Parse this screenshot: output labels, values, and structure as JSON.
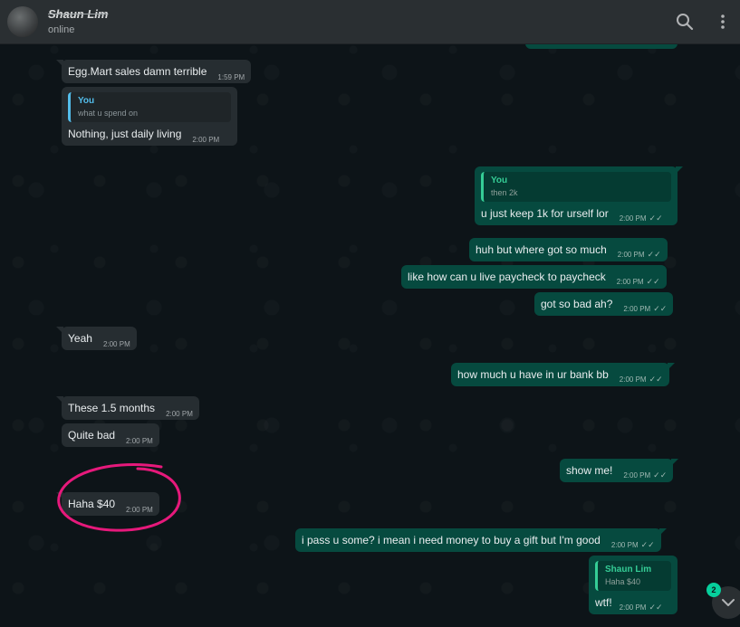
{
  "header": {
    "contact_name": "Shaun Lim",
    "status": "online",
    "icons": [
      "search-icon",
      "menu-icon"
    ]
  },
  "colors": {
    "header_bg": "#2a2f32",
    "chat_bg": "#0d1418",
    "incoming_bubble": "#262d31",
    "outgoing_bubble": "#064a3f",
    "highlight_circle": "#e6197b",
    "unread_badge": "#06cf9c"
  },
  "messages": [
    {
      "direction": "in",
      "text": "Egg.Mart sales damn terrible",
      "time": "1:59 PM"
    },
    {
      "direction": "in",
      "quote_author": "You",
      "quote_text": "what u spend on",
      "text": "Nothing, just daily living",
      "time": "2:00 PM"
    },
    {
      "direction": "out",
      "quote_author": "You",
      "quote_text": "then 2k",
      "text": "u just keep 1k for urself lor",
      "time": "2:00 PM",
      "read": true
    },
    {
      "direction": "out",
      "text": "huh but where got so much",
      "time": "2:00 PM",
      "read": true
    },
    {
      "direction": "out",
      "text": "like how can u live paycheck to paycheck",
      "time": "2:00 PM",
      "read": true
    },
    {
      "direction": "out",
      "text": "got so bad ah?",
      "time": "2:00 PM",
      "read": true
    },
    {
      "direction": "in",
      "text": "Yeah",
      "time": "2:00 PM"
    },
    {
      "direction": "out",
      "text": "how much u have in ur bank bb",
      "time": "2:00 PM",
      "read": true
    },
    {
      "direction": "in",
      "text": "These 1.5 months",
      "time": "2:00 PM"
    },
    {
      "direction": "in",
      "text": "Quite bad",
      "time": "2:00 PM"
    },
    {
      "direction": "out",
      "text": "show me!",
      "time": "2:00 PM",
      "read": true
    },
    {
      "direction": "in",
      "text": "Haha $40",
      "time": "2:00 PM",
      "highlighted": true
    },
    {
      "direction": "out",
      "text": "i pass u some? i mean i need money to buy a gift but I'm good",
      "time": "2:00 PM",
      "read": true
    },
    {
      "direction": "out",
      "quote_author": "Shaun Lim",
      "quote_text": "Haha $40",
      "text": "wtf!",
      "time": "2:00 PM",
      "read": true
    }
  ],
  "scroll_button": {
    "icon": "chevron-down-icon",
    "unread_count": "2"
  }
}
